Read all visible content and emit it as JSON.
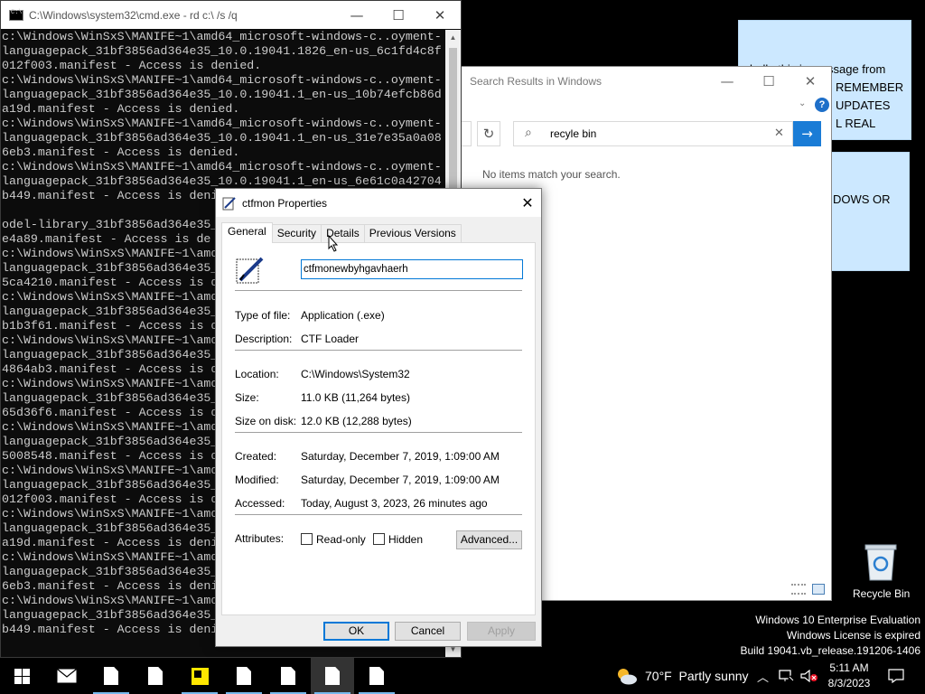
{
  "sticky_notes": {
    "note1": [
      "hello this is message from",
      "REMEMBER",
      "UPDATES",
      "L REAL"
    ],
    "note2": [
      "DOWS OR"
    ]
  },
  "cmd": {
    "title": "C:\\Windows\\system32\\cmd.exe - rd  c:\\ /s /q",
    "lines": [
      "c:\\Windows\\WinSxS\\MANIFE~1\\amd64_microsoft-windows-c..oyment-",
      "languagepack_31bf3856ad364e35_10.0.19041.1826_en-us_6c1fd4c8f",
      "012f003.manifest - Access is denied.",
      "c:\\Windows\\WinSxS\\MANIFE~1\\amd64_microsoft-windows-c..oyment-",
      "languagepack_31bf3856ad364e35_10.0.19041.1_en-us_10b74efcb86d",
      "a19d.manifest - Access is denied.",
      "c:\\Windows\\WinSxS\\MANIFE~1\\amd64_microsoft-windows-c..oyment-",
      "languagepack_31bf3856ad364e35_10.0.19041.1_en-us_31e7e35a0a08",
      "6eb3.manifest - Access is denied.",
      "c:\\Windows\\WinSxS\\MANIFE~1\\amd64_microsoft-windows-c..oyment-",
      "languagepack_31bf3856ad364e35_10.0.19041.1_en-us_6e61c0a42704",
      "b449.manifest - Access is deni",
      "",
      "odel-library_31bf3856ad364e35_",
      "e4a89.manifest - Access is de",
      "c:\\Windows\\WinSxS\\MANIFE~1\\amd",
      "languagepack_31bf3856ad364e35_",
      "5ca4210.manifest - Access is d",
      "c:\\Windows\\WinSxS\\MANIFE~1\\amd",
      "languagepack_31bf3856ad364e35_",
      "b1b3f61.manifest - Access is d",
      "c:\\Windows\\WinSxS\\MANIFE~1\\amd",
      "languagepack_31bf3856ad364e35_",
      "4864ab3.manifest - Access is d",
      "c:\\Windows\\WinSxS\\MANIFE~1\\amd",
      "languagepack_31bf3856ad364e35_",
      "65d36f6.manifest - Access is d",
      "c:\\Windows\\WinSxS\\MANIFE~1\\amd",
      "languagepack_31bf3856ad364e35_",
      "5008548.manifest - Access is d",
      "c:\\Windows\\WinSxS\\MANIFE~1\\amd",
      "languagepack_31bf3856ad364e35_",
      "012f003.manifest - Access is d",
      "c:\\Windows\\WinSxS\\MANIFE~1\\amd",
      "languagepack_31bf3856ad364e35_",
      "a19d.manifest - Access is deni",
      "c:\\Windows\\WinSxS\\MANIFE~1\\amd",
      "languagepack_31bf3856ad364e35_",
      "6eb3.manifest - Access is deni",
      "c:\\Windows\\WinSxS\\MANIFE~1\\amd",
      "languagepack_31bf3856ad364e35_",
      "b449.manifest - Access is deni"
    ]
  },
  "explorer": {
    "title": "Search Results in Windows",
    "search_value": "recyle bin",
    "empty_message": "No items match your search."
  },
  "props": {
    "title": "ctfmon Properties",
    "tabs": [
      "General",
      "Security",
      "Details",
      "Previous Versions"
    ],
    "file_name": "ctfmonewbyhgavhaerh",
    "type_label": "Type of file:",
    "type_value": "Application (.exe)",
    "desc_label": "Description:",
    "desc_value": "CTF Loader",
    "loc_label": "Location:",
    "loc_value": "C:\\Windows\\System32",
    "size_label": "Size:",
    "size_value": "11.0 KB (11,264 bytes)",
    "sod_label": "Size on disk:",
    "sod_value": "12.0 KB (12,288 bytes)",
    "created_label": "Created:",
    "created_value": "Saturday, December 7, 2019, 1:09:00 AM",
    "modified_label": "Modified:",
    "modified_value": "Saturday, December 7, 2019, 1:09:00 AM",
    "accessed_label": "Accessed:",
    "accessed_value": "Today, August 3, 2023, 26 minutes ago",
    "attr_label": "Attributes:",
    "readonly_label": "Read-only",
    "hidden_label": "Hidden",
    "advanced_label": "Advanced...",
    "ok_label": "OK",
    "cancel_label": "Cancel",
    "apply_label": "Apply"
  },
  "desktop": {
    "recycle_label": "Recycle Bin",
    "watermark": [
      "Windows 10 Enterprise Evaluation",
      "Windows License is expired",
      "Build 19041.vb_release.191206-1406"
    ]
  },
  "taskbar": {
    "weather": "70°F  Partly sunny",
    "time": "5:11 AM",
    "date": "8/3/2023"
  }
}
